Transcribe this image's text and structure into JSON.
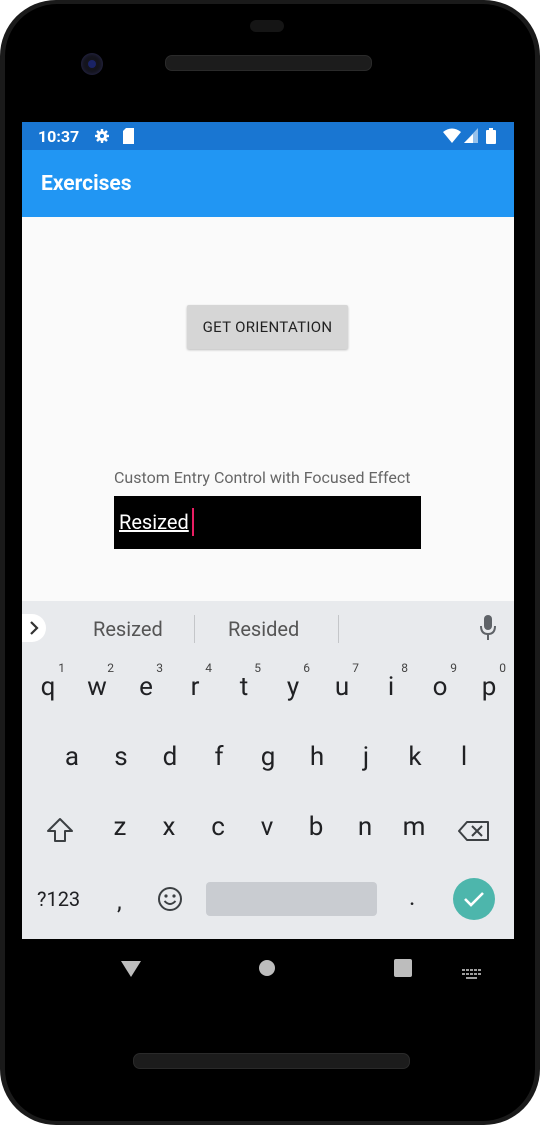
{
  "statusbar": {
    "time": "10:37"
  },
  "appbar": {
    "title": "Exercises"
  },
  "main": {
    "orientation_button": "GET ORIENTATION",
    "entry_label": "Custom Entry Control with Focused Effect",
    "entry_value": "Resized"
  },
  "keyboard": {
    "suggestions": [
      "Resized",
      "Resided"
    ],
    "row1": [
      {
        "k": "q",
        "h": "1"
      },
      {
        "k": "w",
        "h": "2"
      },
      {
        "k": "e",
        "h": "3"
      },
      {
        "k": "r",
        "h": "4"
      },
      {
        "k": "t",
        "h": "5"
      },
      {
        "k": "y",
        "h": "6"
      },
      {
        "k": "u",
        "h": "7"
      },
      {
        "k": "i",
        "h": "8"
      },
      {
        "k": "o",
        "h": "9"
      },
      {
        "k": "p",
        "h": "0"
      }
    ],
    "row2": [
      "a",
      "s",
      "d",
      "f",
      "g",
      "h",
      "j",
      "k",
      "l"
    ],
    "row3": [
      "z",
      "x",
      "c",
      "v",
      "b",
      "n",
      "m"
    ],
    "symbols_key": "?123",
    "comma_key": ",",
    "period_key": "."
  },
  "colors": {
    "status_bar": "#1976d2",
    "app_bar": "#2196f3",
    "enter_key": "#4db6ac",
    "cursor": "#e91e63"
  },
  "icons": [
    "gear-icon",
    "sd-card-icon",
    "wifi-icon",
    "signal-icon",
    "battery-icon",
    "chevron-right-icon",
    "microphone-icon",
    "shift-icon",
    "backspace-icon",
    "emoji-icon",
    "check-icon",
    "back-icon",
    "home-icon",
    "recents-icon",
    "keyboard-switch-icon"
  ]
}
